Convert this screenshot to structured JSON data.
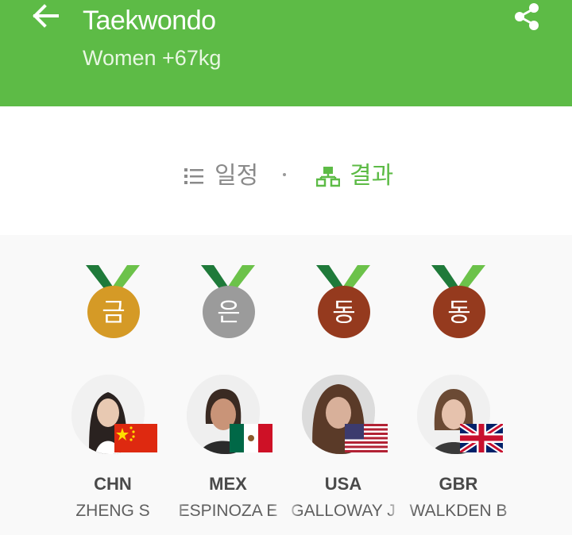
{
  "header": {
    "title": "Taekwondo",
    "subtitle": "Women +67kg",
    "back_icon": "arrow-left-icon",
    "share_icon": "share-icon",
    "background_color": "#5dbb46"
  },
  "tabs": [
    {
      "label": "일정",
      "icon": "list-icon",
      "active": false
    },
    {
      "label": "결과",
      "icon": "bracket-icon",
      "active": true
    }
  ],
  "accent_color": "#5dbb46",
  "results": [
    {
      "medal": "금",
      "medal_color": "#d59a26",
      "noc": "CHN",
      "athlete": "ZHENG S",
      "flag": "flag-china-icon"
    },
    {
      "medal": "은",
      "medal_color": "#9b9b9b",
      "noc": "MEX",
      "athlete": "ESPINOZA E",
      "flag": "flag-mexico-icon"
    },
    {
      "medal": "동",
      "medal_color": "#953a1e",
      "noc": "USA",
      "athlete": "GALLOWAY J",
      "flag": "flag-usa-icon"
    },
    {
      "medal": "동",
      "medal_color": "#953a1e",
      "noc": "GBR",
      "athlete": "WALKDEN B",
      "flag": "flag-uk-icon"
    }
  ]
}
